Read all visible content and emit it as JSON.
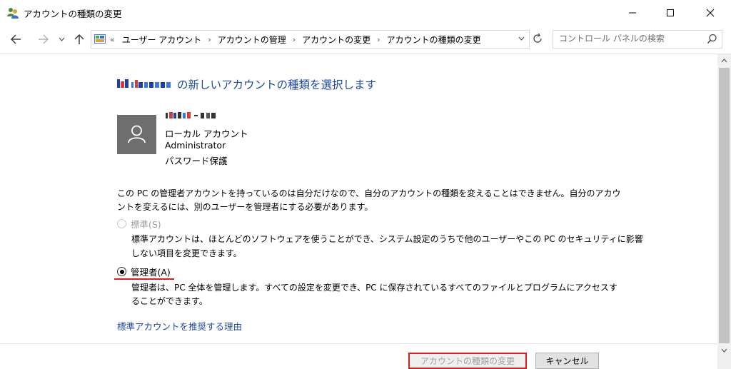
{
  "window": {
    "title": "アカウントの種類の変更",
    "app_icon": "user-accounts-icon"
  },
  "nav": {
    "back_icon": "back-arrow-icon",
    "forward_icon": "forward-arrow-icon",
    "recent_icon": "chevron-down-icon",
    "up_icon": "up-arrow-icon",
    "overflow": "«",
    "breadcrumbs": [
      "ユーザー アカウント",
      "アカウントの管理",
      "アカウントの変更",
      "アカウントの種類の変更"
    ],
    "separator": "›"
  },
  "search": {
    "placeholder": "コントロール パネルの検索"
  },
  "main": {
    "title_suffix": "の新しいアカウントの種類を選択します",
    "account": {
      "type": "ローカル アカウント",
      "role": "Administrator",
      "password": "パスワード保護"
    },
    "warning_line1": "この PC の管理者アカウントを持っているのは自分だけなので、自分のアカウントの種類を変えることはできません。自分のアカウ",
    "warning_line2": "ントを変えるには、別のユーザーを管理者にする必要があります。",
    "options": [
      {
        "label": "標準(S)",
        "selected": false,
        "enabled": false,
        "desc_line1": "標準アカウントは、ほとんどのソフトウェアを使うことができ、システム設定のうちで他のユーザーやこの PC のセキュリティに影響",
        "desc_line2": "しない項目を変更できます。"
      },
      {
        "label": "管理者(A)",
        "selected": true,
        "enabled": true,
        "desc_line1": "管理者は、PC 全体を管理します。すべての設定を変更でき、PC に保存されているすべてのファイルとプログラムにアクセスす",
        "desc_line2": "ることができます。"
      }
    ],
    "link": "標準アカウントを推奨する理由"
  },
  "buttons": {
    "change": "アカウントの種類の変更",
    "cancel": "キャンセル"
  },
  "colors": {
    "accent_blue": "#1e4a9c",
    "highlight_red": "#d92020",
    "disabled_text": "#a0a0a0"
  }
}
